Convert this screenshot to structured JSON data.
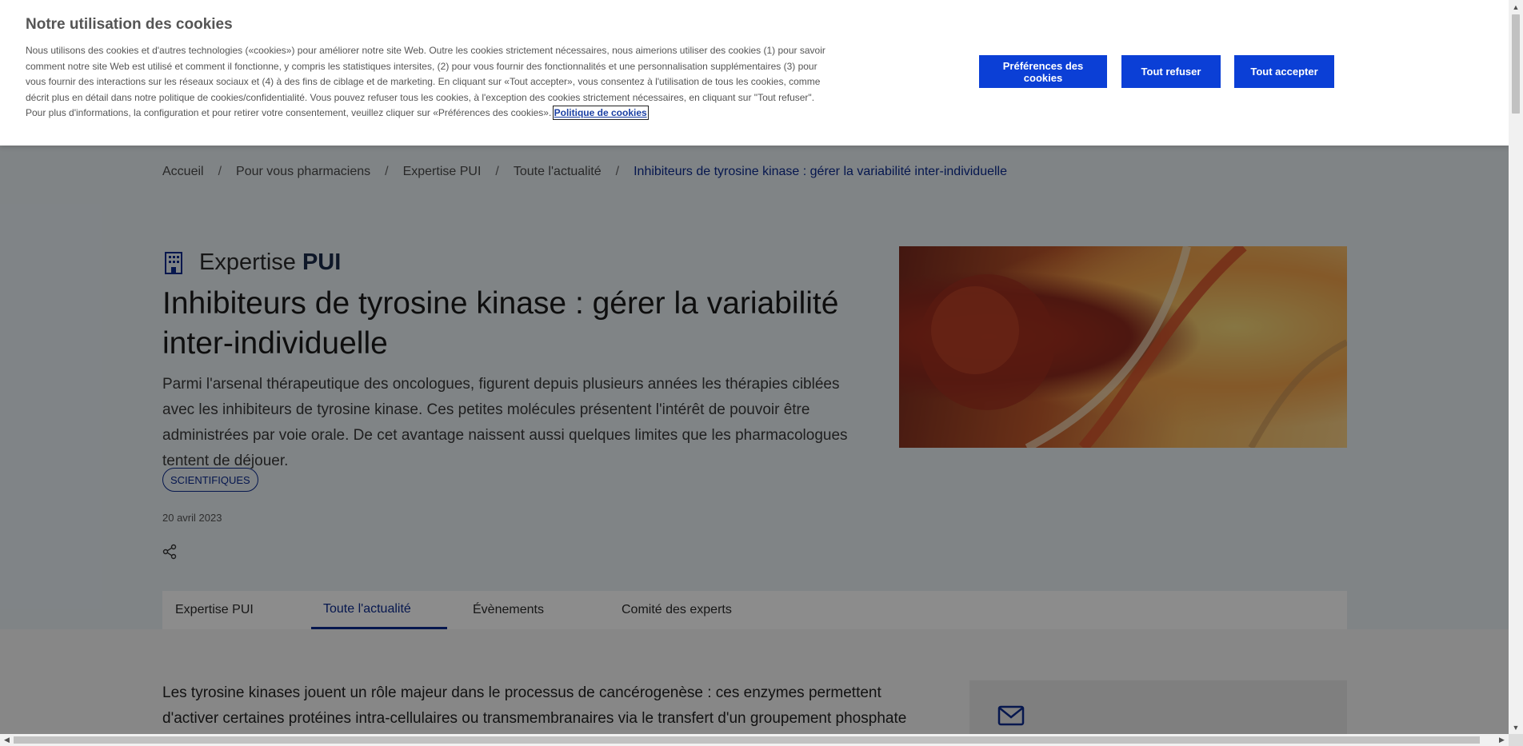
{
  "cookie_banner": {
    "title": "Notre utilisation des cookies",
    "text": "Nous utilisons des cookies et d'autres technologies («cookies») pour améliorer notre site Web. Outre les cookies strictement nécessaires, nous aimerions utiliser des cookies (1) pour savoir comment notre site Web est utilisé et comment il fonctionne, y compris les statistiques intersites, (2) pour vous fournir des fonctionnalités et une personnalisation supplémentaires (3) pour vous fournir des interactions sur les réseaux sociaux et (4) à des fins de ciblage et de marketing. En cliquant sur «Tout accepter», vous consentez à l'utilisation de tous les cookies, comme décrit plus en détail dans notre politique de cookies/confidentialité. Vous pouvez refuser tous les cookies, à l'exception des cookies strictement nécessaires, en cliquant sur \"Tout refuser\". Pour plus d'informations, la configuration et pour retirer votre consentement, veuillez cliquer sur «Préférences des cookies».",
    "policy_link": "Politique de cookies",
    "buttons": {
      "preferences": "Préférences des cookies",
      "refuse": "Tout refuser",
      "accept": "Tout accepter"
    }
  },
  "breadcrumb": {
    "items": [
      "Accueil",
      "Pour vous pharmaciens",
      "Expertise PUI",
      "Toute l'actualité"
    ],
    "current": "Inhibiteurs de tyrosine kinase : gérer la variabilité inter-individuelle",
    "separator": "/"
  },
  "section": {
    "prefix": "Expertise",
    "suffix": "PUI",
    "icon": "building-icon"
  },
  "article": {
    "title": "Inhibiteurs de tyrosine kinase : gérer la variabilité inter-individuelle",
    "lead": "Parmi l'arsenal thérapeutique des oncologues, figurent depuis plusieurs années les thérapies ciblées avec les inhibiteurs de tyrosine kinase. Ces petites molécules présentent l'intérêt de pouvoir être administrées par voie orale. De cet avantage naissent aussi quelques limites que les pharmacologues tentent de déjouer.",
    "tag": "SCIENTIFIQUES",
    "date": "20 avril 2023",
    "body": "Les tyrosine kinases jouent un rôle majeur dans le processus de cancérogenèse : ces enzymes permettent d'activer certaines protéines intra-cellulaires ou transmembranaires via le transfert d'un groupement phosphate issu de"
  },
  "tabs": [
    {
      "label": "Expertise PUI",
      "active": false
    },
    {
      "label": "Toute l'actualité",
      "active": true
    },
    {
      "label": "Évènements",
      "active": false
    },
    {
      "label": "Comité des experts",
      "active": false
    }
  ],
  "colors": {
    "brand_blue": "#0b3fd6",
    "link_blue": "#0b2a8f",
    "overlay": "rgba(0,0,0,0.45)"
  }
}
